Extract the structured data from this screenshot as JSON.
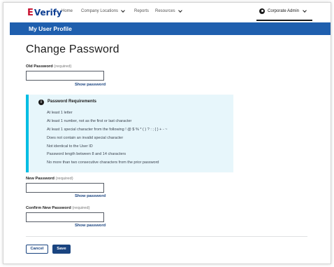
{
  "brand": {
    "logo_mark": "E",
    "logo_text": "Verify"
  },
  "nav": {
    "items": [
      {
        "label": "Home"
      },
      {
        "label": "Company Locations",
        "has_dropdown": true
      },
      {
        "label": "Reports"
      },
      {
        "label": "Resources",
        "has_dropdown": true
      }
    ],
    "user_menu": {
      "label": "Corporate Admin",
      "icon": "user-circle-icon"
    }
  },
  "banner": {
    "title": "My User Profile"
  },
  "page": {
    "title": "Change Password"
  },
  "fields": {
    "old_password": {
      "label": "Old Password",
      "required": "(required)",
      "value": "",
      "show_label": "Show password"
    },
    "new_password": {
      "label": "New Password",
      "required": "(required)",
      "value": "",
      "show_label": "Show password"
    },
    "confirm_password": {
      "label": "Confirm New Password",
      "required": "(required)",
      "value": "",
      "show_label": "Show password"
    }
  },
  "requirements": {
    "icon": "info-icon",
    "heading": "Password Requirements",
    "items": [
      "At least 1 letter",
      "At least 1 number, not as the first or last character",
      "At least 1 special character from the following ! @ $ % * ( ) ? : ; { } + - ~",
      "Does not contain an invalid special character",
      "Not identical to the User ID",
      "Password length between 8 and 14 characters",
      "No more than two consecutive characters from the prior password"
    ]
  },
  "actions": {
    "cancel": "Cancel",
    "save": "Save"
  },
  "colors": {
    "banner": "#1f5fae",
    "primary": "#1a4480",
    "alert_bg": "#e7f6fb",
    "alert_border": "#00bde3",
    "logo_red": "#c8102e"
  }
}
